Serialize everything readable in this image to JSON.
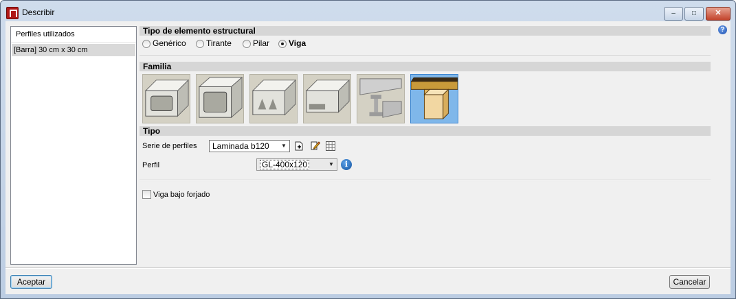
{
  "window": {
    "title": "Describir"
  },
  "title_buttons": {
    "minimize": "–",
    "maximize": "□",
    "close": "✕"
  },
  "help": {
    "glyph": "?"
  },
  "left_panel": {
    "header": "Perfiles utilizados",
    "items": [
      {
        "label": "[Barra] 30 cm x 30 cm",
        "selected": true
      }
    ]
  },
  "element_type": {
    "title": "Tipo de elemento estructural",
    "options": [
      {
        "label": "Genérico",
        "selected": false
      },
      {
        "label": "Tirante",
        "selected": false
      },
      {
        "label": "Pilar",
        "selected": false
      },
      {
        "label": "Viga",
        "selected": true
      }
    ]
  },
  "family": {
    "title": "Familia",
    "items": [
      {
        "icon": "hollow-rectangular-section-icon",
        "selected": false
      },
      {
        "icon": "hollow-square-section-icon",
        "selected": false
      },
      {
        "icon": "voided-slab-section-icon",
        "selected": false
      },
      {
        "icon": "hollow-core-slab-section-icon",
        "selected": false
      },
      {
        "icon": "steel-i-beam-section-icon",
        "selected": false
      },
      {
        "icon": "timber-beam-section-icon",
        "selected": true
      }
    ]
  },
  "tipo": {
    "title": "Tipo",
    "series_label": "Serie de perfiles",
    "series_value": "Laminada b120",
    "profile_label": "Perfil",
    "profile_value": "GL-400x120",
    "info_glyph": "i"
  },
  "options": {
    "viga_bajo_forjado_label": "Viga bajo forjado",
    "viga_bajo_forjado_checked": false
  },
  "buttons": {
    "accept": "Aceptar",
    "cancel": "Cancelar"
  },
  "colors": {
    "selected_family_bg": "#7fb7ea",
    "timber": "#f2d7a2",
    "timber_beam": "#c99a3a"
  }
}
